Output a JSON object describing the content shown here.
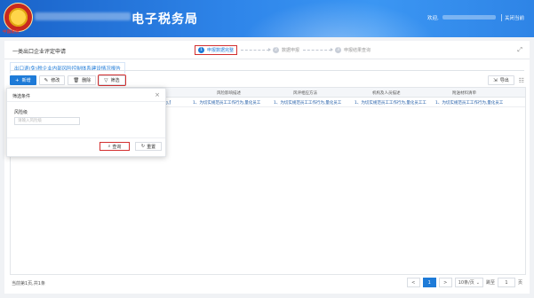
{
  "header": {
    "emblem_text": "中国税务",
    "app_name": "电子税务局",
    "welcome": "欢迎,",
    "logout": "关闭当前"
  },
  "page": {
    "title": "一类出口企业评定申请",
    "expand_icon": "expand-icon",
    "steps": [
      {
        "num": "1",
        "label": "申报数据完整"
      },
      {
        "num": "2",
        "label": "数据申报"
      },
      {
        "num": "3",
        "label": "申报结果查询"
      }
    ],
    "tab_label": "出口退(免)税企业内部风险控制体系建设情况报告"
  },
  "toolbar": {
    "add_label": "新增",
    "edit_label": "修改",
    "delete_label": "删除",
    "filter_label": "筛选",
    "export_label": "导出"
  },
  "table": {
    "columns": [
      "风险影响描述",
      "风评相应方法",
      "机构及人员描述",
      "附送材料清单"
    ],
    "row": [
      "1、为切实规范员工工作行为,量化员工",
      "1、为切实规范员工工作行为,量化员工",
      "1、为切实规范员工工作行为,量化员工",
      "1、为切实规范员工工作行为,量化员工工",
      "1、为切实规范员工工作行为,量化员工"
    ]
  },
  "filter_panel": {
    "title": "筛选条件",
    "field_label": "风险级",
    "field_placeholder": "请输入风险级",
    "query_label": "查询",
    "reset_label": "重置"
  },
  "pagination": {
    "total": "当前第1页,共1条",
    "prev": "<",
    "current": "1",
    "next": ">",
    "page_size": "10条/页",
    "goto_label": "跳至",
    "goto_value": "1",
    "page_unit": "页"
  },
  "colors": {
    "primary": "#1e7bd8",
    "highlight": "#d32f2f",
    "header": "#2f86ea"
  }
}
